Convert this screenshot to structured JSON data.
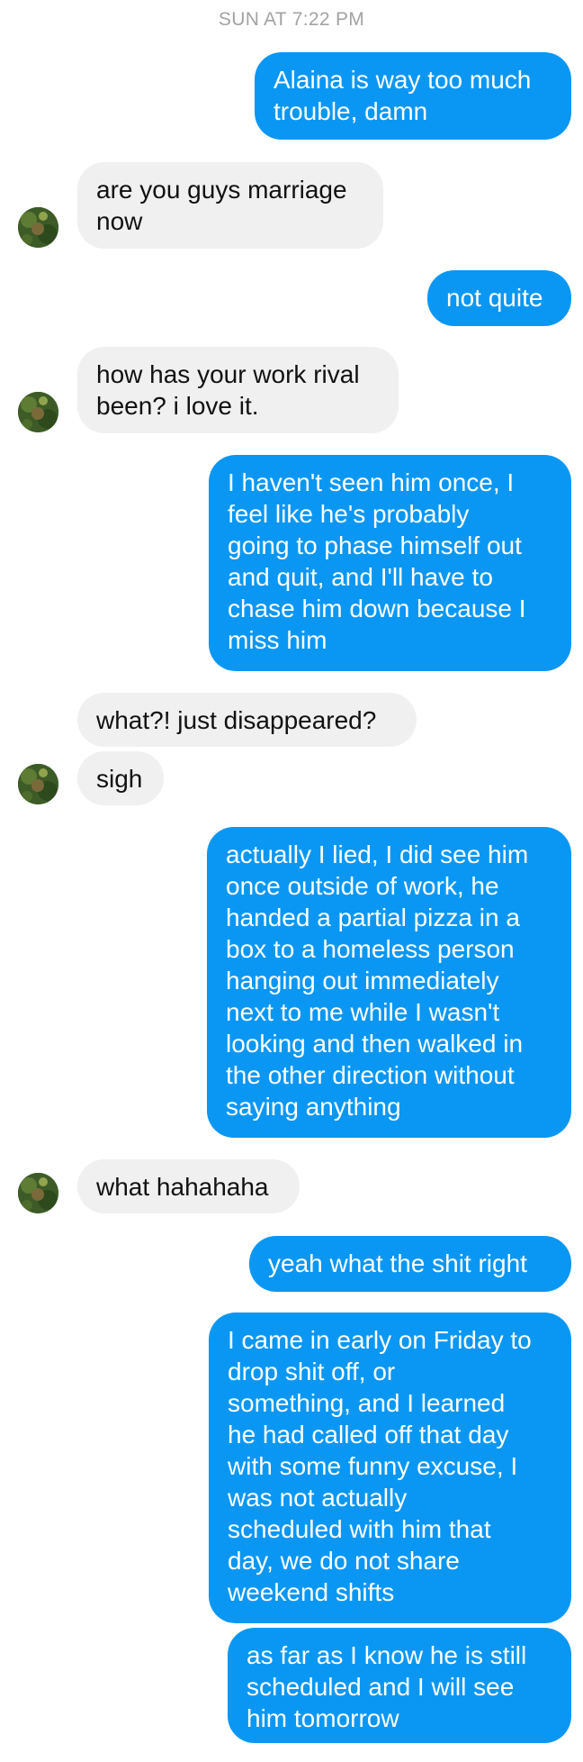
{
  "timestamp": "SUN AT 7:22 PM",
  "messages": [
    {
      "id": "m1",
      "text": "Alaina is way too much\ntrouble, damn"
    },
    {
      "id": "m2",
      "text": "are you guys marriage\nnow"
    },
    {
      "id": "m3",
      "text": "not quite"
    },
    {
      "id": "m4",
      "text": "how has your work rival\nbeen? i love it."
    },
    {
      "id": "m5",
      "text": "I haven't seen him once, I\nfeel like he's probably\ngoing to phase himself out\nand quit, and I'll have to\nchase him down because I\nmiss him"
    },
    {
      "id": "m6",
      "text": "what?! just disappeared?"
    },
    {
      "id": "m7",
      "text": "sigh"
    },
    {
      "id": "m8",
      "text": "actually I lied, I did see him\nonce outside of work, he\nhanded a partial pizza in a\nbox to a homeless person\nhanging out immediately\nnext to me while I wasn't\nlooking and then walked in\nthe other direction without\nsaying anything"
    },
    {
      "id": "m9",
      "text": "what hahahaha"
    },
    {
      "id": "m10",
      "text": "yeah what the shit right"
    },
    {
      "id": "m11",
      "text": "I came in early on Friday to\ndrop shit off, or\nsomething, and I learned\nhe had called off that day\nwith some funny excuse, I\nwas not actually\nscheduled with him that\nday, we do not share\nweekend shifts"
    },
    {
      "id": "m12",
      "text": "as far as I know he is still\nscheduled and I will see\nhim tomorrow"
    }
  ],
  "colors": {
    "outgoing_bubble": "#0a97f3",
    "incoming_bubble": "#f1f0f0",
    "timestamp_text": "#a3a3a3"
  },
  "avatar_icon": "contact-avatar-icon"
}
